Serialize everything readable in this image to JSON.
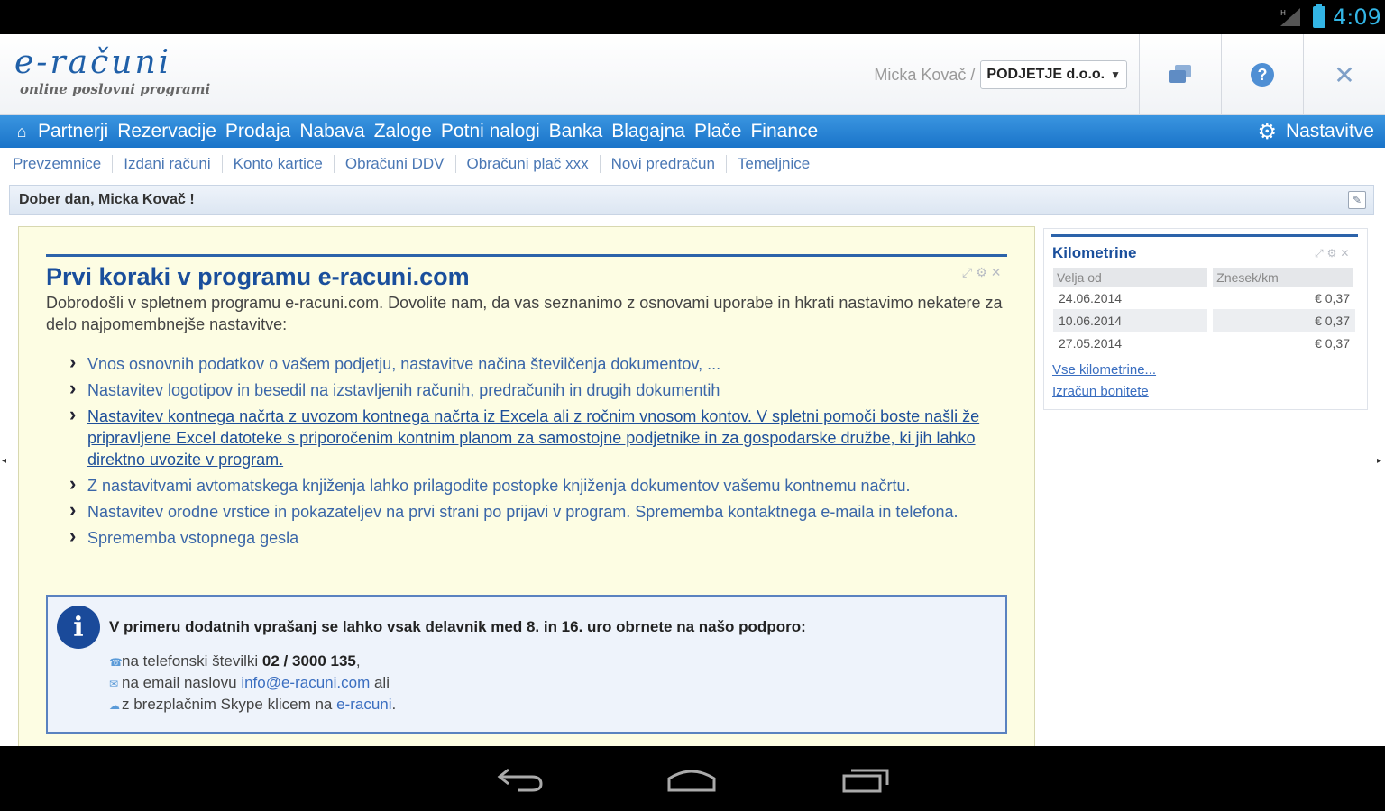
{
  "statusbar": {
    "time": "4:09"
  },
  "header": {
    "brand": "e-računi",
    "tagline": "online poslovni programi",
    "user": "Micka Kovač /",
    "company": "PODJETJE d.o.o."
  },
  "menu": {
    "items": [
      "Partnerji",
      "Rezervacije",
      "Prodaja",
      "Nabava",
      "Zaloge",
      "Potni nalogi",
      "Banka",
      "Blagajna",
      "Plače",
      "Finance"
    ],
    "settings": "Nastavitve"
  },
  "submenu": {
    "items": [
      "Prevzemnice",
      "Izdani računi",
      "Konto kartice",
      "Obračuni DDV",
      "Obračuni plač xxx",
      "Novi predračun",
      "Temeljnice"
    ]
  },
  "greeting": "Dober dan, Micka Kovač !",
  "main": {
    "title": "Prvi koraki v programu e-racuni.com",
    "intro": "Dobrodošli v spletnem programu e-racuni.com. Dovolite nam, da vas seznanimo z osnovami uporabe in hkrati nastavimo nekatere za delo najpomembnejše nastavitve:",
    "steps": [
      "Vnos osnovnih podatkov o vašem podjetju, nastavitve načina številčenja dokumentov, ...",
      "Nastavitev logotipov in besedil na izstavljenih računih, predračunih in drugih dokumentih",
      "Nastavitev kontnega načrta z uvozom kontnega načrta iz Excela ali z ročnim vnosom kontov. V spletni pomoči boste našli že pripravljene Excel datoteke s priporočenim kontnim planom za samostojne podjetnike in za gospodarske družbe, ki jih lahko direktno uvozite v program.",
      "Z nastavitvami avtomatskega knjiženja lahko prilagodite postopke knjiženja dokumentov vašemu kontnemu načrtu.",
      "Nastavitev orodne vrstice in pokazateljev na prvi strani po prijavi v program. Sprememba kontaktnega e-maila in telefona.",
      "Sprememba vstopnega gesla"
    ],
    "info": {
      "title": "V primeru dodatnih vprašanj se lahko vsak delavnik med 8. in 16. uro obrnete na našo podporo:",
      "phone_prefix": "na telefonski številki ",
      "phone": "02 / 3000 135",
      "phone_suffix": ",",
      "email_prefix": "na email naslovu ",
      "email": "info@e-racuni.com",
      "email_suffix": " ali",
      "skype_prefix": "z brezplačnim Skype klicem na ",
      "skype": "e-racuni",
      "skype_suffix": "."
    }
  },
  "side": {
    "title": "Kilometrine",
    "col1": "Velja od",
    "col2": "Znesek/km",
    "rows": [
      {
        "date": "24.06.2014",
        "amount": "€ 0,37"
      },
      {
        "date": "10.06.2014",
        "amount": "€ 0,37"
      },
      {
        "date": "27.05.2014",
        "amount": "€ 0,37"
      }
    ],
    "link1": "Vse kilometrine...",
    "link2": "Izračun bonitete"
  },
  "icons": [
    "home-icon",
    "gear-icon",
    "chat-icon",
    "help-icon",
    "close-icon",
    "info-icon",
    "phone-icon",
    "email-icon",
    "skype-icon",
    "back-icon",
    "home-nav-icon",
    "recents-icon"
  ],
  "colors": {
    "accent": "#1a74c9",
    "brand": "#1f5fa8",
    "panel_bg": "#fdfde3",
    "status_text": "#33b5e5"
  }
}
